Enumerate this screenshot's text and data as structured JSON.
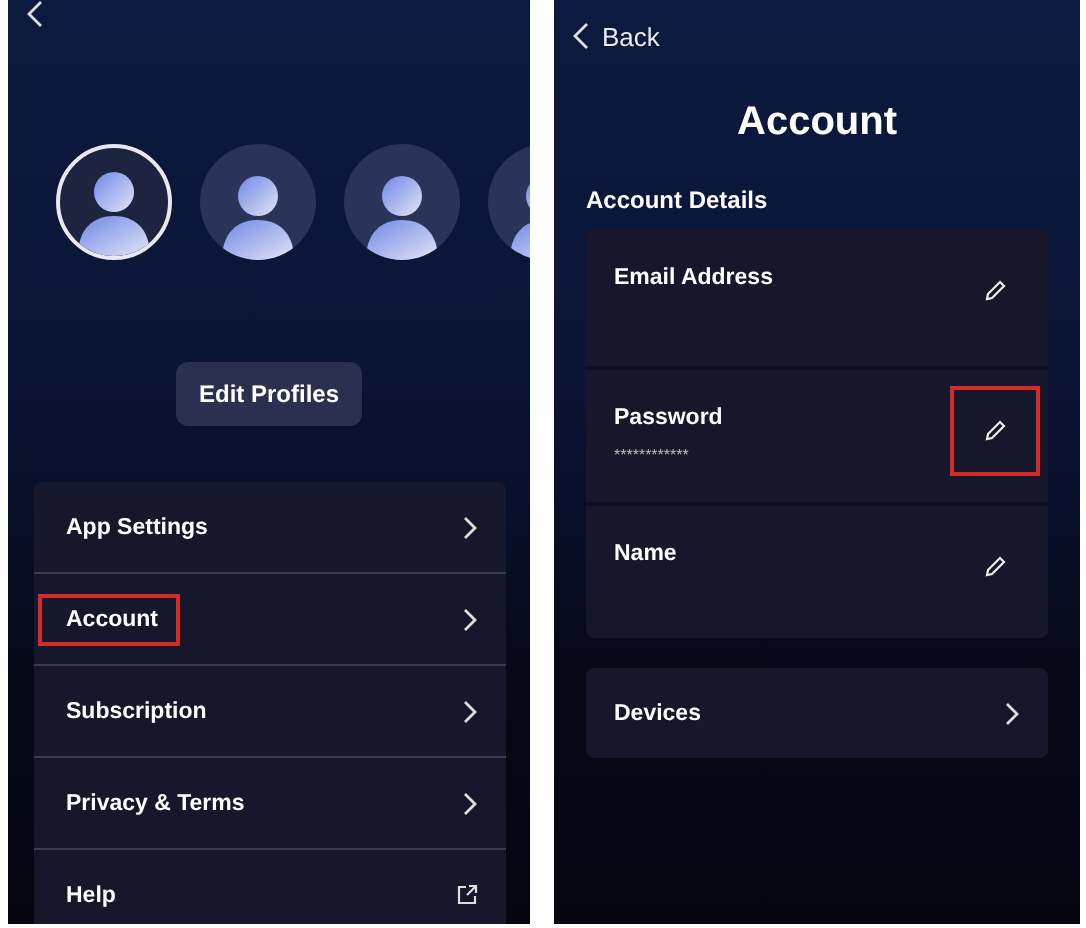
{
  "profiles_screen": {
    "profiles": [
      {
        "selected": true
      },
      {
        "selected": false
      },
      {
        "selected": false
      },
      {
        "selected": false
      }
    ],
    "edit_button": "Edit Profiles",
    "menu": [
      {
        "label": "App Settings",
        "kind": "link",
        "highlighted": false
      },
      {
        "label": "Account",
        "kind": "link",
        "highlighted": true
      },
      {
        "label": "Subscription",
        "kind": "link",
        "highlighted": false
      },
      {
        "label": "Privacy & Terms",
        "kind": "link",
        "highlighted": false
      },
      {
        "label": "Help",
        "kind": "external",
        "highlighted": false
      }
    ]
  },
  "account_screen": {
    "back": "Back",
    "title": "Account",
    "section": "Account Details",
    "details": [
      {
        "label": "Email Address",
        "highlighted": false
      },
      {
        "label": "Password",
        "value": "************",
        "highlighted": true
      },
      {
        "label": "Name",
        "highlighted": false
      }
    ],
    "links": [
      {
        "label": "Devices"
      }
    ]
  }
}
